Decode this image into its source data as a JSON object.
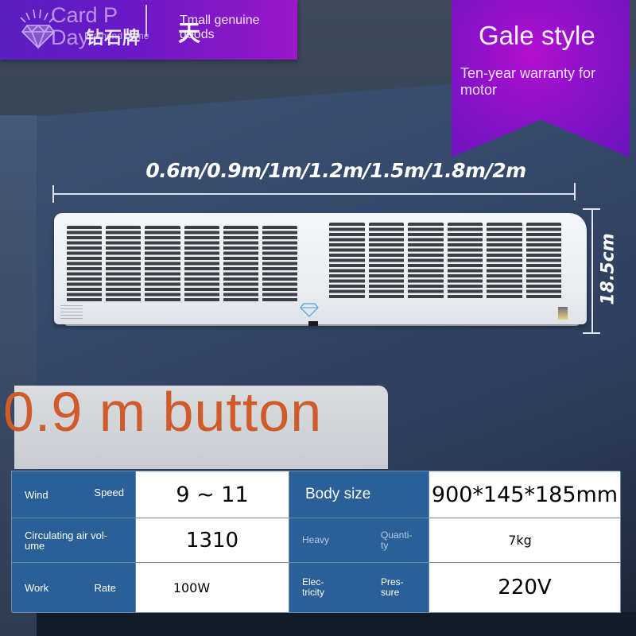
{
  "banner": {
    "brand_en": "Card P Day",
    "brand_sub": "Diamond name",
    "brand_cn": "钻石牌",
    "tmall_cn": "天",
    "tmall_en": "Tmall genuine goods"
  },
  "ribbon": {
    "title": "Gale style",
    "subtitle": "Ten-year warranty for motor",
    "color": "#8a12c8"
  },
  "dimensions": {
    "width_label": "0.6m/0.9m/1m/1.2m/1.5m/1.8m/2m",
    "height_label": "18.5cm"
  },
  "product": {
    "name": "air-curtain",
    "icon": "diamond-logo-icon"
  },
  "model": {
    "title": "0.9 m button",
    "color": "#cf5a2a"
  },
  "specs": {
    "header_color": "#2a5f98",
    "rows": [
      {
        "left_label_a": "Wind",
        "left_label_b": "Speed",
        "left_value": "9 ~ 11",
        "right_label": "Body size",
        "right_value": "900*145*185mm"
      },
      {
        "left_label": "Circulating air vol-ume",
        "left_value": "1310",
        "right_label_a": "Heavy",
        "right_label_b": "Quanti-ty",
        "right_value": "7kg"
      },
      {
        "left_label_a": "Work",
        "left_label_b": "Rate",
        "left_value": "100W",
        "right_label_a": "Elec-tricity",
        "right_label_b": "Pres-sure",
        "right_value": "220V"
      }
    ]
  }
}
